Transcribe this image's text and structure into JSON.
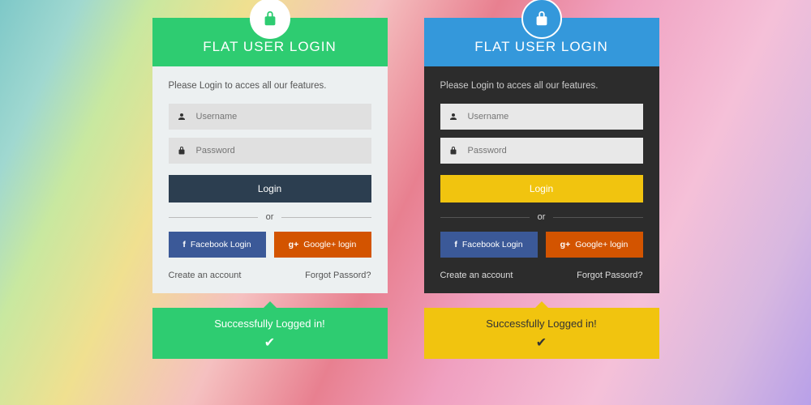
{
  "left": {
    "title": "FLAT USER LOGIN",
    "prompt": "Please Login to acces all our features.",
    "username_placeholder": "Username",
    "password_placeholder": "Password",
    "login_label": "Login",
    "or_label": "or",
    "facebook_label": "Facebook Login",
    "google_label": "Google+ login",
    "create_account": "Create an account",
    "forgot": "Forgot Passord?",
    "toast": "Successfully Logged in!"
  },
  "right": {
    "title": "FLAT USER LOGIN",
    "prompt": "Please Login to acces all our features.",
    "username_placeholder": "Username",
    "password_placeholder": "Password",
    "login_label": "Login",
    "or_label": "or",
    "facebook_label": "Facebook Login",
    "google_label": "Google+ login",
    "create_account": "Create an account",
    "forgot": "Forgot Passord?",
    "toast": "Successfully Logged in!"
  },
  "colors": {
    "green": "#2ecc71",
    "blue": "#3498db",
    "darknavy": "#2c3e50",
    "yellow": "#f1c40f",
    "facebook": "#3b5998",
    "google": "#d35400"
  }
}
